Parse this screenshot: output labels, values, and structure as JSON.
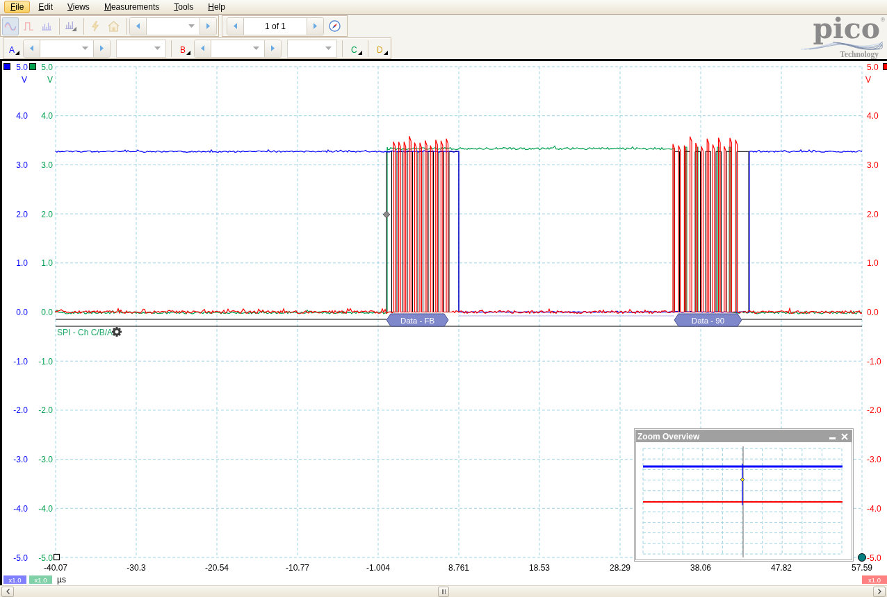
{
  "menu": [
    {
      "label": "File",
      "selected": true
    },
    {
      "label": "Edit",
      "selected": false
    },
    {
      "label": "Views",
      "selected": false
    },
    {
      "label": "Measurements",
      "selected": false
    },
    {
      "label": "Tools",
      "selected": false
    },
    {
      "label": "Help",
      "selected": false
    }
  ],
  "view_modes": [
    {
      "selected": true
    },
    {
      "selected": false
    },
    {
      "selected": false
    }
  ],
  "page_nav": {
    "value": "1 of 1"
  },
  "channels": [
    {
      "label": "A",
      "color": "#0000ff",
      "kind": "ranged"
    },
    {
      "label": "B",
      "color": "#ff0000",
      "kind": "ranged"
    },
    {
      "label": "C",
      "color": "#00a050",
      "kind": "plain"
    },
    {
      "label": "D",
      "color": "#d4a017",
      "kind": "plain"
    }
  ],
  "logo": {
    "wordmark": "pico$^{®}$",
    "tagline": "Technology"
  },
  "scope": {
    "left_axes": [
      {
        "color": "#0000ff",
        "unit": "V",
        "scale": "x1.0",
        "ticks": [
          "5.0",
          "4.0",
          "3.0",
          "2.0",
          "1.0",
          "0.0",
          "-1.0",
          "-2.0",
          "-3.0",
          "-4.0",
          "-5.0"
        ]
      },
      {
        "color": "#00a050",
        "unit": "V",
        "scale": "x1.0",
        "ticks": [
          "5.0",
          "4.0",
          "3.0",
          "2.0",
          "1.0",
          "0.0",
          "-1.0",
          "-2.0",
          "-3.0",
          "-4.0",
          "-5.0"
        ]
      }
    ],
    "right_axis": {
      "color": "#ff0000",
      "unit": "V",
      "scale": "x1.0",
      "ticks": [
        "5.0",
        "4.0",
        "3.0",
        "2.0",
        "1.0",
        "0.0",
        "-1.0",
        "-2.0",
        "-3.0",
        "-4.0",
        "-5.0"
      ]
    },
    "time_ticks": [
      "-40.07",
      "-30.3",
      "-20.54",
      "-10.77",
      "-1.004",
      "8.761",
      "18.53",
      "28.29",
      "38.06",
      "47.82",
      "57.59"
    ],
    "time_unit": "µs",
    "decoder": {
      "label": "SPI - Ch C/B/A",
      "packets": [
        "Data - FB",
        "Data - 90"
      ]
    },
    "zoom_overview": {
      "title": "Zoom Overview"
    }
  }
}
